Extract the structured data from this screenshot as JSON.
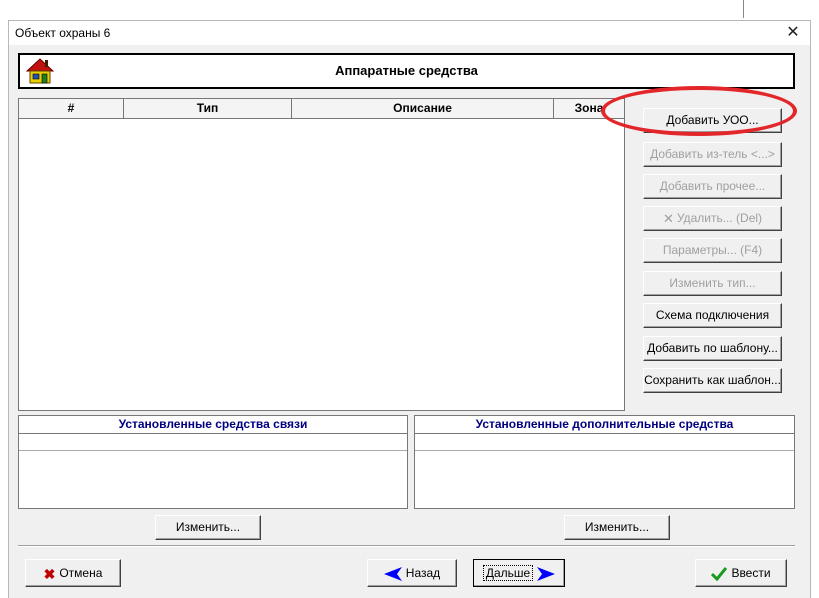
{
  "window": {
    "title": "Объект охраны 6",
    "close_glyph": "✕"
  },
  "header": {
    "title": "Аппаратные средства",
    "icon": "house-icon"
  },
  "table": {
    "columns": [
      "#",
      "Тип",
      "Описание",
      "Зона"
    ],
    "rows": []
  },
  "side_buttons": [
    {
      "label": "Добавить УОО...",
      "enabled": true
    },
    {
      "label": "Добавить из-тель <...>",
      "enabled": false
    },
    {
      "label": "Добавить прочее...",
      "enabled": false
    },
    {
      "label": "Удалить... (Del)",
      "enabled": false,
      "icon": "delete-x-icon"
    },
    {
      "label": "Параметры... (F4)",
      "enabled": false
    },
    {
      "label": "Изменить тип...",
      "enabled": false
    },
    {
      "label": "Схема подключения",
      "enabled": true
    },
    {
      "label": "Добавить по шаблону...",
      "enabled": true
    },
    {
      "label": "Сохранить как шаблон...",
      "enabled": true
    }
  ],
  "annotation": {
    "highlight_color": "#e3262a",
    "target": "Добавить УОО..."
  },
  "panels": {
    "comm": {
      "title": "Установленные средства связи",
      "change_label": "Изменить..."
    },
    "extra": {
      "title": "Установленные дополнительные средства",
      "change_label": "Изменить..."
    }
  },
  "footer": {
    "cancel_label": "Отмена",
    "back_label": "Назад",
    "next_label": "Дальше",
    "enter_label": "Ввести"
  },
  "colors": {
    "panel_title": "#000080",
    "cancel_icon": "#c00000",
    "arrow_icon": "#0000ff",
    "check_icon": "#1a9a1a"
  }
}
